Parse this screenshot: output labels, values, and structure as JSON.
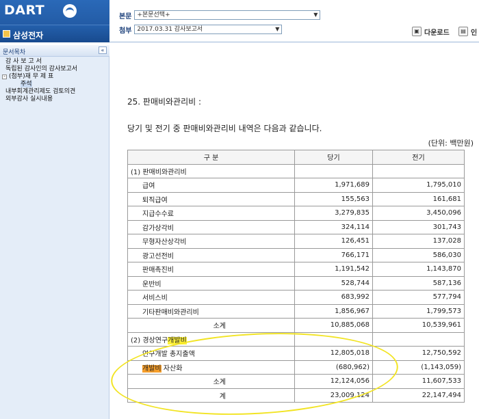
{
  "header": {
    "logo": "DART",
    "company": "삼성전자",
    "main_doc_label": "본문",
    "main_doc_value": "+본문선택+",
    "attach_label": "첨부",
    "attach_value": "2017.03.31   감사보고서",
    "download_label": "다운로드",
    "print_label": "인"
  },
  "sidebar": {
    "title": "문서목차",
    "collapse": "«",
    "items": [
      {
        "label": "감 사 보 고 서"
      },
      {
        "label": "독립된 감사인의 감사보고서"
      },
      {
        "label": "(첨부)재 무 제 표"
      },
      {
        "label": "주석"
      },
      {
        "label": "내부회계관리제도 검토의견"
      },
      {
        "label": "외부감사 실시내용"
      }
    ]
  },
  "content": {
    "section_title": "25. 판매비와관리비 :",
    "description": "당기 및 전기 중 판매비와관리비 내역은 다음과 같습니다.",
    "unit": "(단위: 백만원)",
    "table": {
      "headers": [
        "구      분",
        "당기",
        "전기"
      ],
      "rows": [
        {
          "label": "(1) 판매비와관리비",
          "cur": "",
          "prev": ""
        },
        {
          "label": "급여",
          "cur": "1,971,689",
          "prev": "1,795,010"
        },
        {
          "label": "퇴직급여",
          "cur": "155,563",
          "prev": "161,681"
        },
        {
          "label": "지급수수료",
          "cur": "3,279,835",
          "prev": "3,450,096"
        },
        {
          "label": "감가상각비",
          "cur": "324,114",
          "prev": "301,743"
        },
        {
          "label": "무형자산상각비",
          "cur": "126,451",
          "prev": "137,028"
        },
        {
          "label": "광고선전비",
          "cur": "766,171",
          "prev": "586,030"
        },
        {
          "label": "판매촉진비",
          "cur": "1,191,542",
          "prev": "1,143,870"
        },
        {
          "label": "운반비",
          "cur": "528,744",
          "prev": "587,136"
        },
        {
          "label": "서비스비",
          "cur": "683,992",
          "prev": "577,794"
        },
        {
          "label": "기타판매비와관리비",
          "cur": "1,856,967",
          "prev": "1,799,573"
        },
        {
          "label": "소계",
          "cur": "10,885,068",
          "prev": "10,539,961"
        },
        {
          "label_pre": "(2) 경상연구",
          "label_hl": "개발비",
          "cur": "",
          "prev": ""
        },
        {
          "label": "연구개발 총지출액",
          "cur": "12,805,018",
          "prev": "12,750,592"
        },
        {
          "label_hl": "개발비",
          "label_post": " 자산화",
          "cur": "(680,962)",
          "prev": "(1,143,059)"
        },
        {
          "label": "소계",
          "cur": "12,124,056",
          "prev": "11,607,533"
        },
        {
          "label": "계",
          "cur": "23,009,124",
          "prev": "22,147,494"
        }
      ]
    }
  }
}
